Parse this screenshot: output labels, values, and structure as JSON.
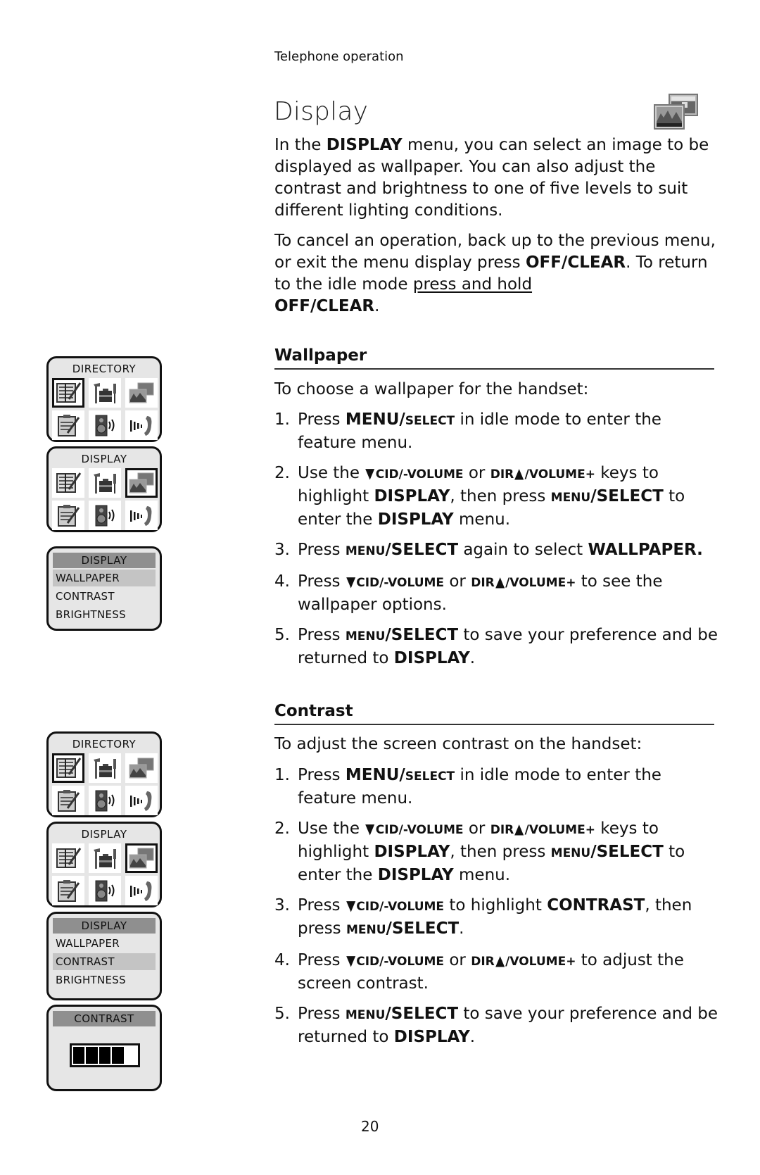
{
  "header": {
    "section": "Telephone operation"
  },
  "title": "Display",
  "title_icon": "wallpaper-pictures-icon",
  "intro": {
    "p1": [
      "In the ",
      "DISPLAY",
      " menu, you can select an image to be displayed as wallpaper. You can also adjust the contrast and brightness to one of five levels to suit different lighting conditions."
    ],
    "p2": [
      "To cancel an operation, back up to the previous menu, or exit the menu display press ",
      "OFF/CLEAR",
      ". To return to the idle mode ",
      "press and hold",
      " ",
      "OFF/CLEAR",
      "."
    ]
  },
  "keys": {
    "menu": "MENU/",
    "select_small": "SELECT",
    "menu_small": "MENU",
    "select": "/SELECT",
    "cid": "CID/-VOLUME",
    "dir": "DIR",
    "vol_up": "/VOLUME+",
    "down_icon": "▼",
    "up_icon": "▲"
  },
  "wallpaper": {
    "heading": "Wallpaper",
    "intro": "To choose a wallpaper for the handset:",
    "steps": [
      {
        "num": "1.",
        "a": "Press ",
        "b": " in idle mode to enter the feature menu."
      },
      {
        "num": "2.",
        "a": "Use the ",
        "or": " or ",
        "b": " keys to highlight ",
        "display": "DISPLAY",
        "c": ", then press ",
        "d": " to enter the ",
        "e": " menu."
      },
      {
        "num": "3.",
        "a": "Press ",
        "b": " again to select ",
        "target": "WALLPAPER."
      },
      {
        "num": "4.",
        "a": "Press ",
        "or": " or ",
        "b": " to see the wallpaper options."
      },
      {
        "num": "5.",
        "a": "Press ",
        "b": " to save your preference and be returned to ",
        "target": "DISPLAY",
        "end": "."
      }
    ]
  },
  "contrast": {
    "heading": "Contrast",
    "intro": "To adjust the screen contrast on the handset:",
    "steps": [
      {
        "num": "1.",
        "a": "Press ",
        "b": " in idle mode to enter the feature menu."
      },
      {
        "num": "2.",
        "a": "Use the ",
        "or": " or ",
        "b": " keys to highlight ",
        "display": "DISPLAY",
        "c": ", then press ",
        "d": " to enter the ",
        "e": " menu."
      },
      {
        "num": "3.",
        "a": "Press ",
        "b": " to highlight ",
        "target": "CONTRAST",
        "c": ", then press ",
        "end": "."
      },
      {
        "num": "4.",
        "a": "Press ",
        "or": " or ",
        "b": " to adjust the screen contrast."
      },
      {
        "num": "5.",
        "a": "Press ",
        "b": " to save your preference and be returned to ",
        "target": "DISPLAY",
        "end": "."
      }
    ]
  },
  "screens": {
    "directory_title": "DIRECTORY",
    "display_title": "DISPLAY",
    "menu_items": [
      "WALLPAPER",
      "CONTRAST",
      "BRIGHTNESS"
    ],
    "contrast_title": "CONTRAST",
    "contrast_level": 4,
    "contrast_max": 5,
    "icons": [
      "directory-book-icon",
      "settings-tools-icon",
      "display-pictures-icon",
      "memo-clipboard-icon",
      "ringer-speaker-icon",
      "intercom-handset-icon"
    ]
  },
  "page_number": "20"
}
